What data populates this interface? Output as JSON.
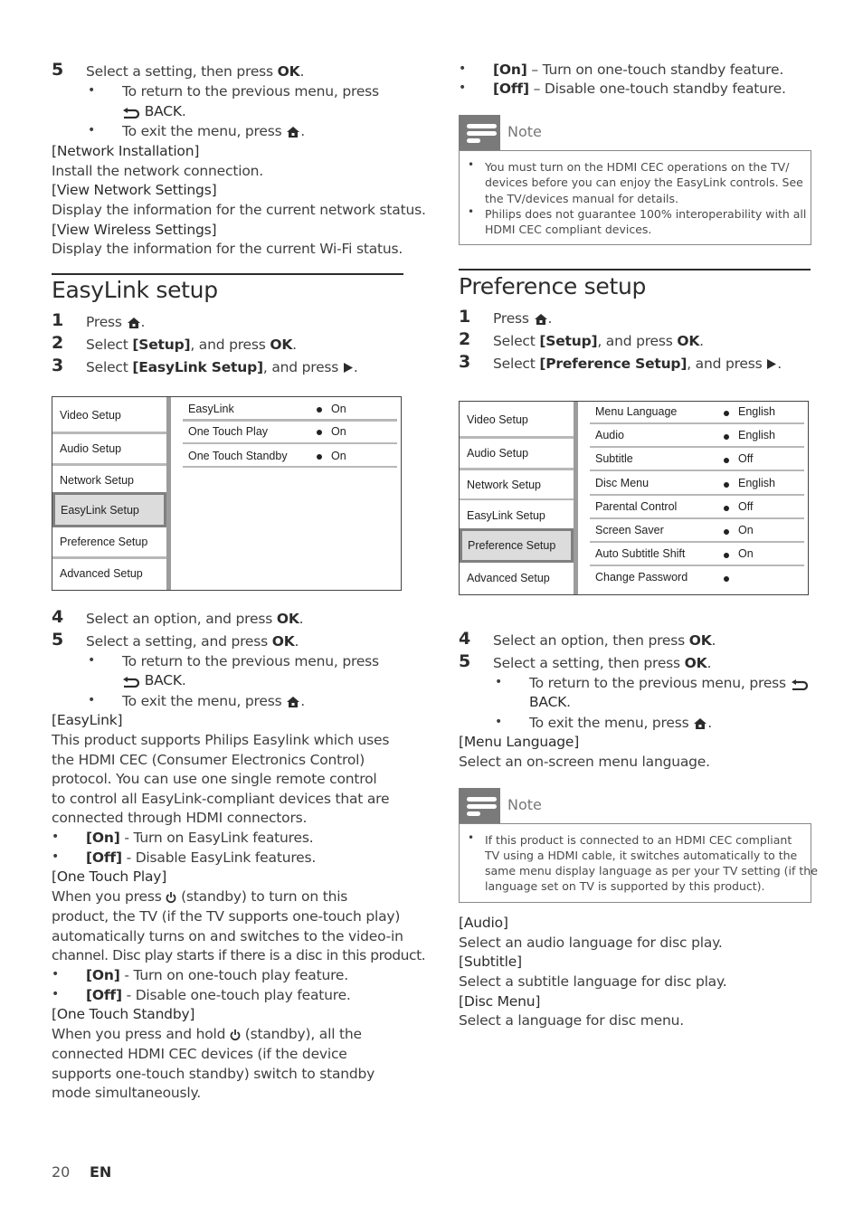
{
  "left": {
    "top_steps": {
      "step5_num": "5",
      "step5_text": "Select a setting, then press ",
      "step5_ok": "OK",
      "bullet1_text": "To return to the previous menu, press",
      "bullet1_back": "BACK",
      "bullet2_text": "To exit the menu, press ",
      "period": "."
    },
    "network_items": [
      {
        "title": "[Network Installation]",
        "desc": "Install the network connection."
      },
      {
        "title": "[View Network Settings]",
        "desc": "Display the information for the current network status."
      },
      {
        "title": "[View Wireless Settings]",
        "desc": "Display the information for the current Wi-Fi status."
      }
    ],
    "easylink_heading": "EasyLink setup",
    "easylink_steps": [
      {
        "num": "1",
        "pre": "Press ",
        "bold": "",
        "post": "",
        "icon": "home-icon"
      },
      {
        "num": "2",
        "pre": "Select ",
        "bold": "[Setup]",
        "post": ", and press ",
        "ok": "OK",
        "end": "."
      },
      {
        "num": "3",
        "pre": "Select ",
        "bold": "[EasyLink Setup]",
        "post": ", and press ",
        "icon": "play-icon"
      }
    ],
    "menu": {
      "items": [
        "Video Setup",
        "Audio Setup",
        "Network Setup",
        "EasyLink Setup",
        "Preference Setup",
        "Advanced Setup"
      ],
      "selected": "EasyLink Setup",
      "options": [
        {
          "label": "EasyLink",
          "value": "On"
        },
        {
          "label": "One Touch Play",
          "value": "On"
        },
        {
          "label": "One Touch Standby",
          "value": "On"
        }
      ]
    },
    "after_steps": {
      "step4_num": "4",
      "step4_text": "Select an option, and press ",
      "step4_ok": "OK",
      "step5_num": "5",
      "step5_text": "Select a setting, and press ",
      "step5_ok": "OK",
      "bullet1_text": "To return to the previous menu, press",
      "bullet1_back": "BACK",
      "bullet2_text": "To exit the menu, press "
    },
    "easylink_desc": {
      "title": "[EasyLink]",
      "lines": [
        "This product supports Philips Easylink which uses",
        "the HDMI CEC (Consumer Electronics Control)",
        "protocol. You can use one single remote control",
        "to control all EasyLink-compliant devices that are",
        "connected through HDMI connectors."
      ],
      "on_label": "[On]",
      "on_text": " - Turn on EasyLink features.",
      "off_label": "[Off]",
      "off_text": " - Disable EasyLink features."
    },
    "one_touch_play": {
      "title": "[One Touch Play]",
      "line1_pre": "When you press ",
      "line1_post": " (standby) to turn on this",
      "lines": [
        "product, the TV (if the TV supports one-touch play)",
        "automatically turns on and switches to the video-in",
        "channel. Disc play starts if there is a disc in this product."
      ],
      "on_label": "[On]",
      "on_text": " - Turn on one-touch play feature.",
      "off_label": "[Off]",
      "off_text": " - Disable one-touch play feature."
    },
    "one_touch_standby": {
      "title": "[One Touch Standby]",
      "line1_pre": "When you press and hold ",
      "line1_post": " (standby), all the",
      "lines": [
        "connected HDMI CEC devices (if the device",
        "supports one-touch standby) switch to standby",
        "mode simultaneously."
      ]
    }
  },
  "right": {
    "standby_options": {
      "on_label": "[On]",
      "on_text": " – Turn on one-touch standby feature.",
      "off_label": "[Off]",
      "off_text": " – Disable one-touch standby feature."
    },
    "note1": {
      "title": "Note",
      "bullets": [
        [
          "You must turn on the HDMI CEC operations on the TV/",
          "devices before you can enjoy the EasyLink controls. See",
          "the TV/devices manual for details."
        ],
        [
          "Philips does not guarantee 100% interoperability with all",
          "HDMI CEC compliant devices."
        ]
      ]
    },
    "preference_heading": "Preference setup",
    "preference_steps": [
      {
        "num": "1",
        "pre": "Press "
      },
      {
        "num": "2",
        "pre": "Select ",
        "bold": "[Setup]",
        "post": ", and press ",
        "ok": "OK",
        "end": "."
      },
      {
        "num": "3",
        "pre": "Select ",
        "bold": "[Preference Setup]",
        "post": ", and press "
      }
    ],
    "menu": {
      "items": [
        "Video Setup",
        "Audio Setup",
        "Network Setup",
        "EasyLink Setup",
        "Preference Setup",
        "Advanced Setup"
      ],
      "selected": "Preference Setup",
      "options": [
        {
          "label": "Menu Language",
          "value": "English"
        },
        {
          "label": "Audio",
          "value": "English"
        },
        {
          "label": "Subtitle",
          "value": "Off"
        },
        {
          "label": "Disc Menu",
          "value": "English"
        },
        {
          "label": "Parental Control",
          "value": "Off"
        },
        {
          "label": "Screen Saver",
          "value": "On"
        },
        {
          "label": "Auto Subtitle Shift",
          "value": "On"
        },
        {
          "label": "Change Password",
          "value": ""
        }
      ]
    },
    "after_steps": {
      "step4_num": "4",
      "step4_text": "Select an option, then press ",
      "step4_ok": "OK",
      "step5_num": "5",
      "step5_text": "Select a setting, then press ",
      "step5_ok": "OK",
      "bullet1_text": "To return to the previous menu, press ",
      "bullet1_back": "BACK",
      "bullet2_text": "To exit the menu, press "
    },
    "menu_language": {
      "title": "[Menu Language]",
      "desc": "Select an on-screen menu language."
    },
    "note2": {
      "title": "Note",
      "bullets": [
        [
          "If this product is connected to an HDMI CEC compliant",
          "TV using a HDMI cable, it switches automatically to the",
          "same menu display language as per your TV setting (if the",
          "language set on TV is supported by this product)."
        ]
      ]
    },
    "pref_items": [
      {
        "title": "[Audio]",
        "desc": "Select an audio language for disc play."
      },
      {
        "title": "[Subtitle]",
        "desc": "Select a subtitle language for disc play."
      },
      {
        "title": "[Disc Menu]",
        "desc": "Select a language for disc menu."
      }
    ]
  },
  "footer": {
    "page_number": "20",
    "language": "EN"
  }
}
